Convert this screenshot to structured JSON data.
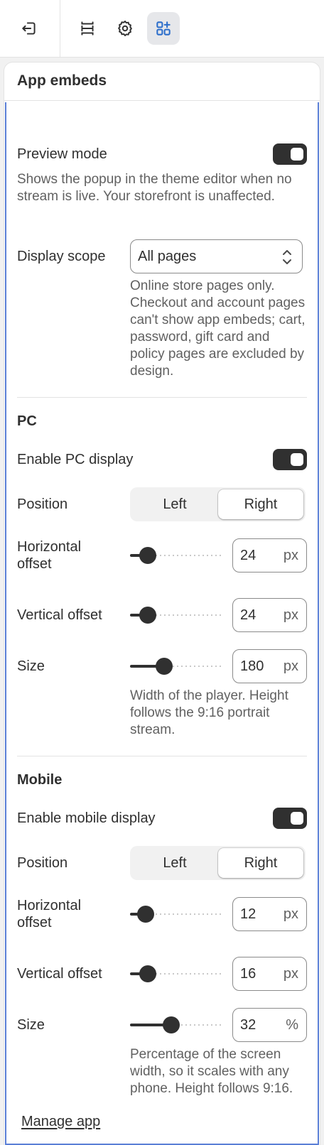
{
  "toolbar": {
    "buttons": [
      {
        "icon": "exit-icon"
      },
      {
        "icon": "sections-icon"
      },
      {
        "icon": "gear-icon"
      },
      {
        "icon": "app-embeds-icon",
        "active": true
      }
    ]
  },
  "panel": {
    "title": "App embeds",
    "preview": {
      "label": "Preview mode",
      "enabled": true,
      "help": "Shows the popup in the theme editor when no stream is live. Your storefront is unaffected."
    },
    "display_scope": {
      "label": "Display scope",
      "value": "All pages",
      "help": "Online store pages only. Checkout and account pages can't show app embeds; cart, password, gift card and policy pages are excluded by design."
    },
    "pc": {
      "heading": "PC",
      "enable_label": "Enable PC display",
      "enabled": true,
      "position_label": "Position",
      "position_options": [
        "Left",
        "Right"
      ],
      "position_selected": "Right",
      "h_offset_label": "Horizontal offset",
      "h_offset_value": "24",
      "h_offset_unit": "px",
      "h_offset_fraction": 0.19,
      "v_offset_label": "Vertical offset",
      "v_offset_value": "24",
      "v_offset_unit": "px",
      "v_offset_fraction": 0.19,
      "size_label": "Size",
      "size_value": "180",
      "size_unit": "px",
      "size_fraction": 0.36,
      "size_help": "Width of the player. Height follows the 9:16 portrait stream."
    },
    "mobile": {
      "heading": "Mobile",
      "enable_label": "Enable mobile display",
      "enabled": true,
      "position_label": "Position",
      "position_options": [
        "Left",
        "Right"
      ],
      "position_selected": "Right",
      "h_offset_label": "Horizontal offset",
      "h_offset_value": "12",
      "h_offset_unit": "px",
      "h_offset_fraction": 0.17,
      "v_offset_label": "Vertical offset",
      "v_offset_value": "16",
      "v_offset_unit": "px",
      "v_offset_fraction": 0.19,
      "size_label": "Size",
      "size_value": "32",
      "size_unit": "%",
      "size_fraction": 0.44,
      "size_help": "Percentage of the screen width, so it scales with any phone. Height follows 9:16."
    },
    "manage_link": "Manage app"
  },
  "colors": {
    "accent_border": "#5b7fd6",
    "toggle_on": "#303030",
    "text": "#303030",
    "muted": "#616161"
  }
}
